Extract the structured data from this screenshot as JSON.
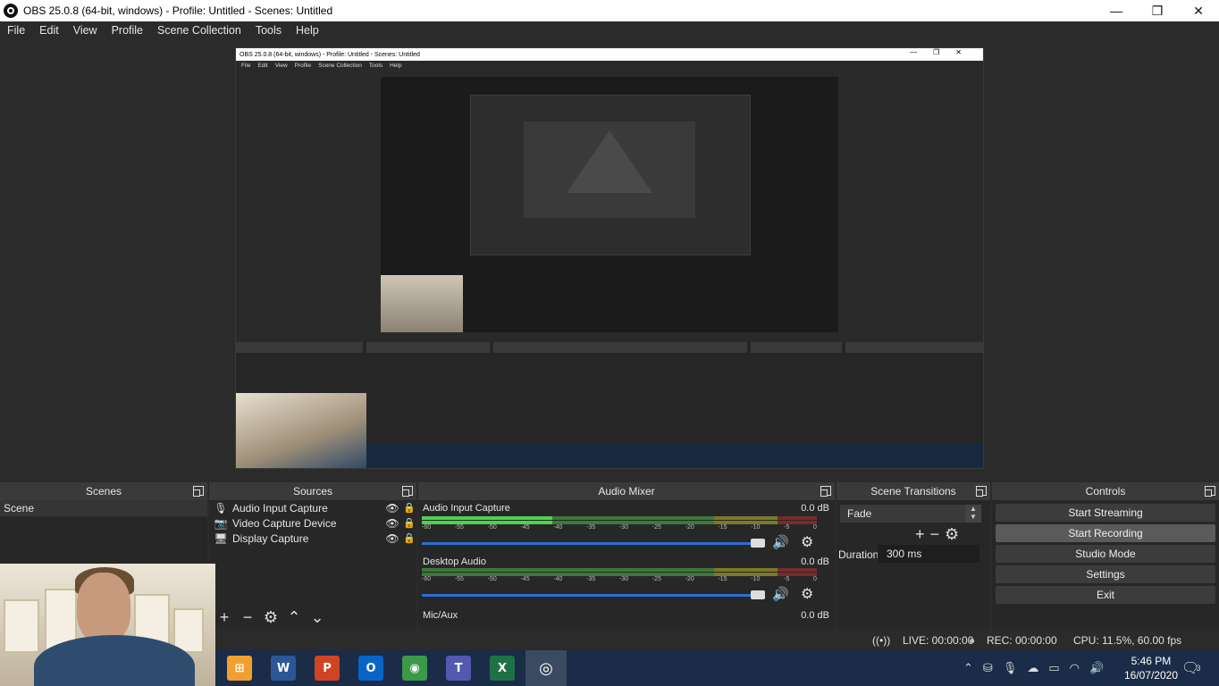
{
  "window": {
    "title": "OBS 25.0.8 (64-bit, windows) - Profile: Untitled - Scenes: Untitled",
    "minimize": "—",
    "maximize": "❐",
    "close": "✕"
  },
  "menu": [
    "File",
    "Edit",
    "View",
    "Profile",
    "Scene Collection",
    "Tools",
    "Help"
  ],
  "preview": {
    "title": "OBS 25.0.8 (64-bit, windows) - Profile: Untitled - Scenes: Untitled",
    "menu": [
      "File",
      "Edit",
      "View",
      "Profile",
      "Scene Collection",
      "Tools",
      "Help"
    ]
  },
  "docks": {
    "scenes": {
      "title": "Scenes",
      "items": [
        "Scene"
      ]
    },
    "sources": {
      "title": "Sources",
      "items": [
        {
          "label": "Audio Input Capture",
          "icon": "microphone-icon"
        },
        {
          "label": "Video Capture Device",
          "icon": "camera-icon"
        },
        {
          "label": "Display Capture",
          "icon": "monitor-icon"
        }
      ]
    },
    "mixer": {
      "title": "Audio Mixer",
      "ticks": [
        "-60",
        "-55",
        "-50",
        "-45",
        "-40",
        "-35",
        "-30",
        "-25",
        "-20",
        "-15",
        "-10",
        "-5",
        "0"
      ],
      "channels": [
        {
          "name": "Audio Input Capture",
          "db": "0.0 dB"
        },
        {
          "name": "Desktop Audio",
          "db": "0.0 dB"
        },
        {
          "name": "Mic/Aux",
          "db": "0.0 dB"
        }
      ]
    },
    "transitions": {
      "title": "Scene Transitions",
      "selected": "Fade",
      "duration_label": "Duration",
      "duration_value": "300 ms"
    },
    "controls": {
      "title": "Controls",
      "buttons": [
        "Start Streaming",
        "Start Recording",
        "Studio Mode",
        "Settings",
        "Exit"
      ]
    }
  },
  "status": {
    "live": "LIVE: 00:00:00",
    "rec": "REC: 00:00:00",
    "cpu": "CPU: 11.5%, 60.00 fps"
  },
  "taskbar": {
    "time": "5:46 PM",
    "date": "16/07/2020",
    "notifications": "3",
    "apps": [
      {
        "name": "start",
        "glyph": "⊞",
        "color": "#f0a030"
      },
      {
        "name": "word",
        "glyph": "W",
        "color": "#2b5797"
      },
      {
        "name": "powerpoint",
        "glyph": "P",
        "color": "#d04423"
      },
      {
        "name": "outlook",
        "glyph": "O",
        "color": "#0a64c8"
      },
      {
        "name": "chrome",
        "glyph": "◉",
        "color": "#3b9a48"
      },
      {
        "name": "teams",
        "glyph": "T",
        "color": "#5558af"
      },
      {
        "name": "excel",
        "glyph": "X",
        "color": "#1e7145"
      },
      {
        "name": "obs",
        "glyph": "◎",
        "color": "#2c2c2c"
      }
    ]
  },
  "colors": {
    "meter_green": "#4cd34c",
    "fader_blue": "#2a6fd6",
    "taskbar": "#1a2c48"
  }
}
